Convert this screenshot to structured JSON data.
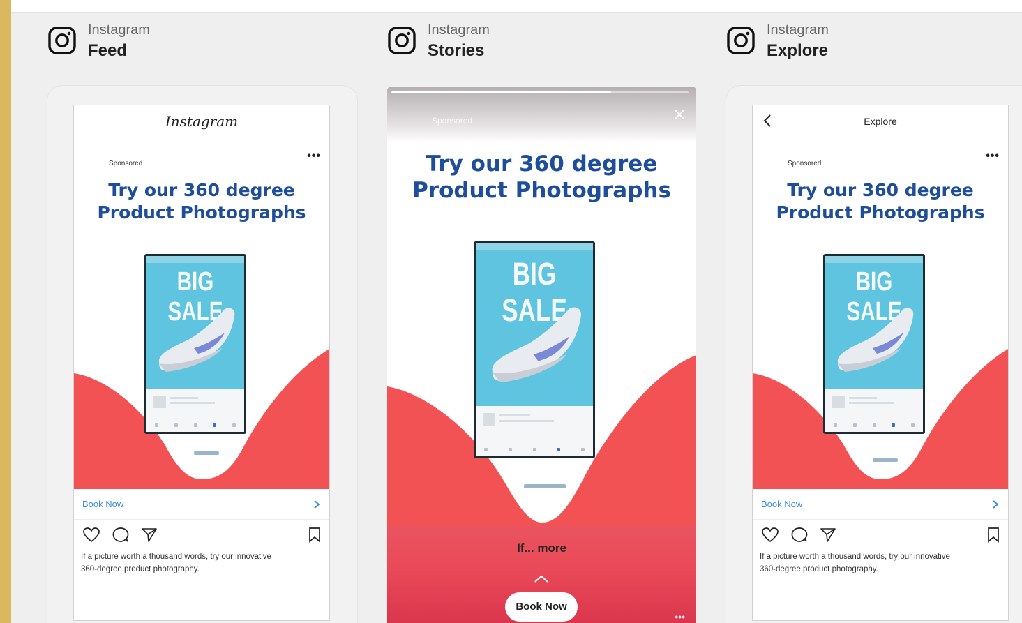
{
  "columns": [
    {
      "platform": "Instagram",
      "placement": "Feed",
      "icon": "instagram-icon"
    },
    {
      "platform": "Instagram",
      "placement": "Stories",
      "icon": "instagram-icon"
    },
    {
      "platform": "Instagram",
      "placement": "Explore",
      "icon": "instagram-icon"
    }
  ],
  "feed": {
    "header_logo": "Instagram",
    "sponsored": "Sponsored",
    "more_dots": "•••",
    "cta_label": "Book Now",
    "caption_line1": "If a picture worth a thousand words, try our innovative",
    "caption_line2": "360-degree product photography."
  },
  "story": {
    "sponsored": "Sponsored",
    "more_prefix": "If...",
    "more_link": "more",
    "cta_label": "Book Now",
    "more_dots": "•••"
  },
  "explore": {
    "header_title": "Explore",
    "sponsored": "Sponsored",
    "more_dots": "•••",
    "cta_label": "Book Now",
    "caption_line1": "If a picture worth a thousand words, try our innovative",
    "caption_line2": "360-degree product photography."
  },
  "ad": {
    "headline_line1": "Try our 360 degree",
    "headline_line2": "Product Photographs",
    "product_banner": "BIG SALE"
  },
  "colors": {
    "headline": "#1e4e9a",
    "wave": "#f25253",
    "cta_link": "#3b8ee0",
    "frame_accent": "#d9b860"
  }
}
